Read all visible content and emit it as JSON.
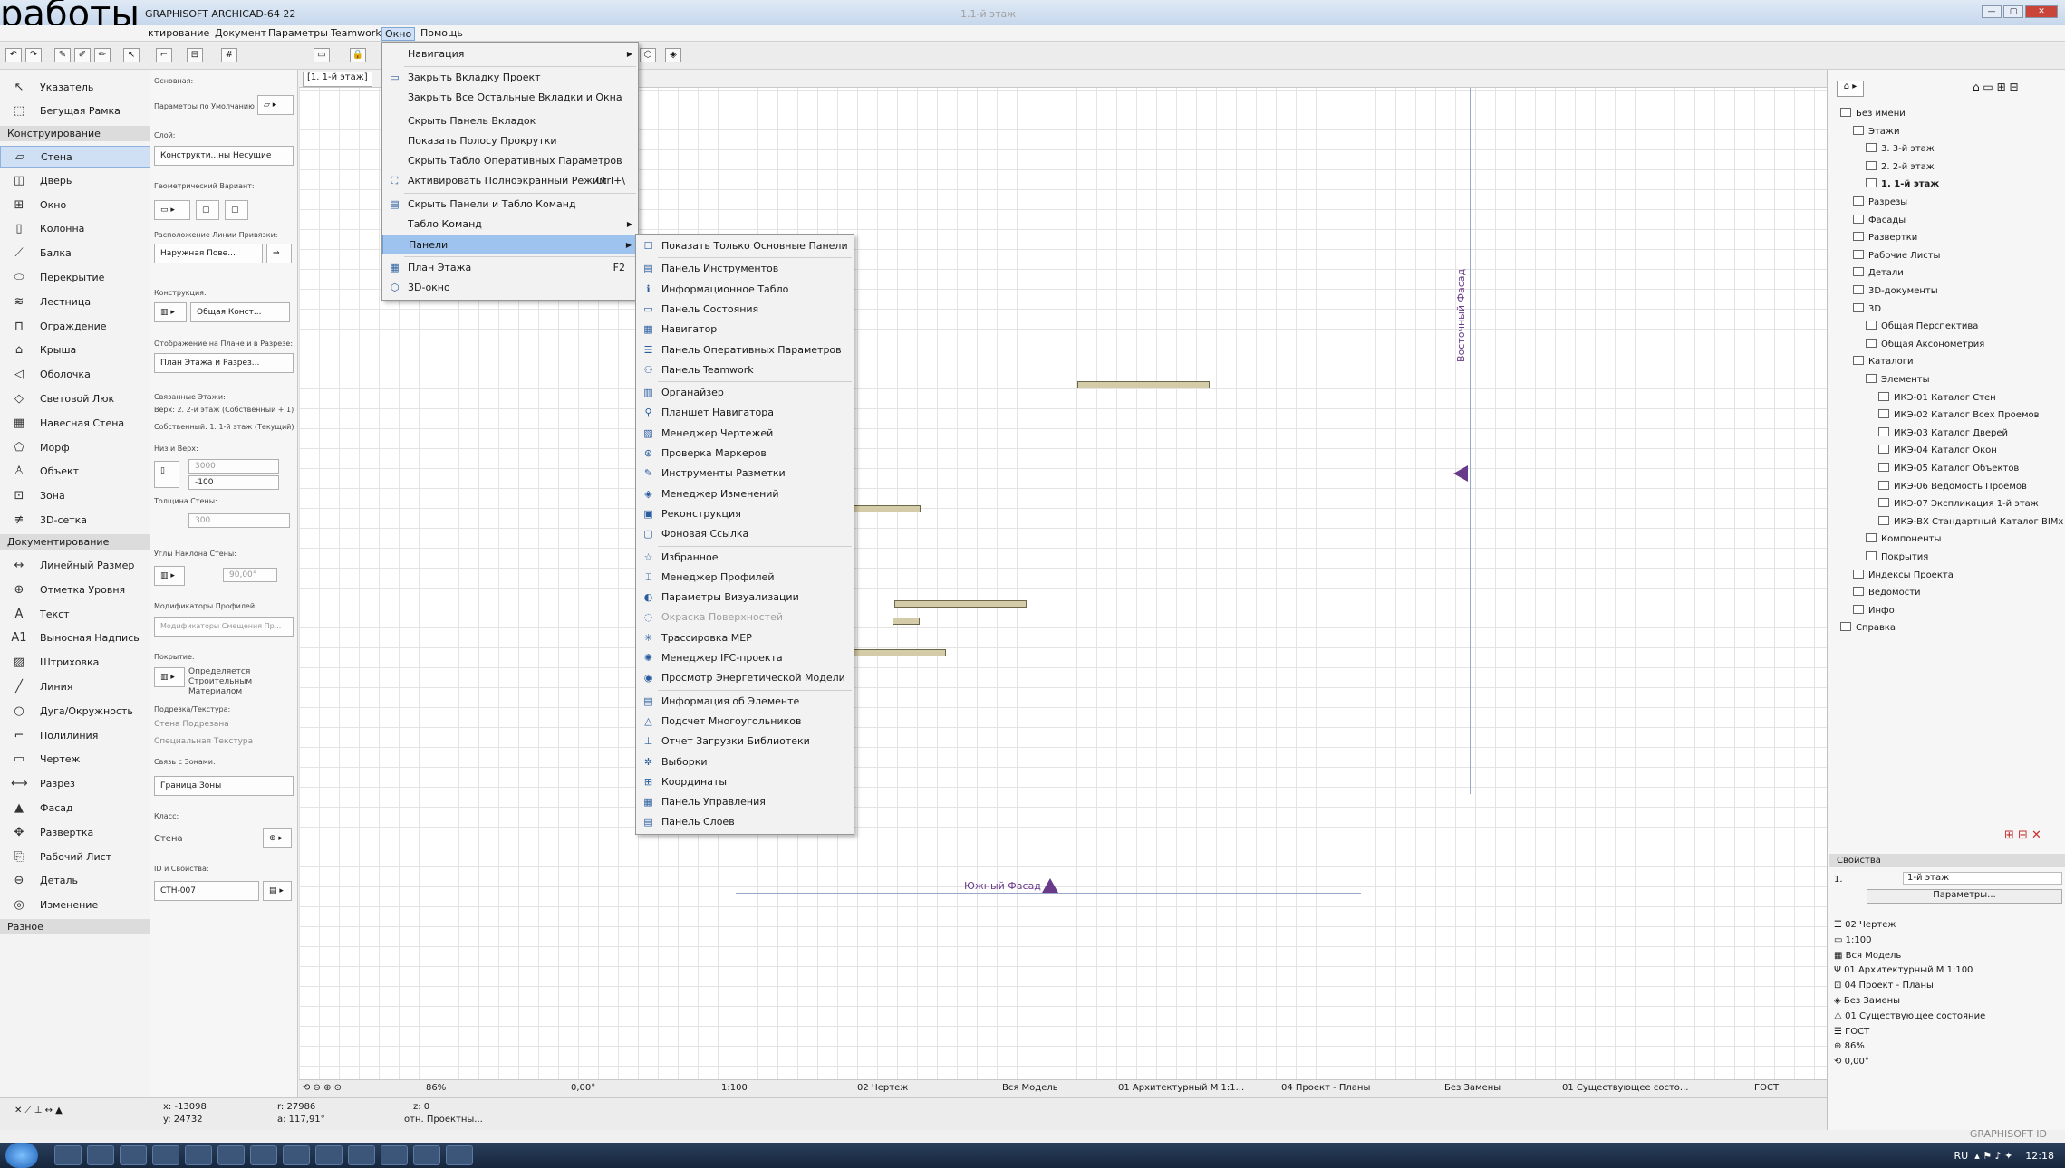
{
  "overlay_caption": "работы",
  "app": {
    "title": "GRAPHISOFT ARCHICAD-64 22",
    "doc_title": "1.1-й этаж"
  },
  "menubar": [
    "ктирование",
    "Документ",
    "Параметры",
    "Teamwork",
    "Окно",
    "Помощь"
  ],
  "window_menu": {
    "items": [
      {
        "label": "Навигация",
        "arrow": "▶"
      },
      {
        "label": "Закрыть Вкладку Проект",
        "icon": "close-tab-icon"
      },
      {
        "label": "Закрыть Все Остальные Вкладки и Окна"
      },
      {
        "label": "Скрыть Панель Вкладок"
      },
      {
        "label": "Показать Полосу Прокрутки"
      },
      {
        "label": "Скрыть Табло Оперативных Параметров"
      },
      {
        "label": "Активировать Полноэкранный Режим",
        "key": "Ctrl+\\",
        "icon": "fullscreen-icon"
      },
      {
        "label": "Скрыть Панели и Табло Команд",
        "icon": "hide-panels-icon"
      },
      {
        "label": "Табло Команд",
        "arrow": "▶"
      },
      {
        "label": "Панели",
        "arrow": "▶",
        "highlighted": true
      },
      {
        "label": "План Этажа",
        "key": "F2",
        "icon": "floor-plan-icon"
      },
      {
        "label": "3D-окно",
        "icon": "3d-window-icon"
      }
    ]
  },
  "panels_submenu": {
    "items": [
      {
        "label": "Показать Только Основные Панели",
        "icon": "☐"
      },
      {
        "label": "Панель Инструментов",
        "icon": "▤"
      },
      {
        "label": "Информационное Табло",
        "icon": "ℹ"
      },
      {
        "label": "Панель Состояния",
        "icon": "▭"
      },
      {
        "label": "Навигатор",
        "icon": "▦"
      },
      {
        "label": "Панель Оперативных Параметров",
        "icon": "☰"
      },
      {
        "label": "Панель Teamwork",
        "icon": "⚇"
      },
      {
        "label": "Органайзер",
        "icon": "▥"
      },
      {
        "label": "Планшет Навигатора",
        "icon": "⚲"
      },
      {
        "label": "Менеджер Чертежей",
        "icon": "▧"
      },
      {
        "label": "Проверка Маркеров",
        "icon": "⊛"
      },
      {
        "label": "Инструменты Разметки",
        "icon": "✎"
      },
      {
        "label": "Менеджер Изменений",
        "icon": "◈"
      },
      {
        "label": "Реконструкция",
        "icon": "▣"
      },
      {
        "label": "Фоновая Ссылка",
        "icon": "▢"
      },
      {
        "label": "Избранное",
        "icon": "☆"
      },
      {
        "label": "Менеджер Профилей",
        "icon": "⌶"
      },
      {
        "label": "Параметры Визуализации",
        "icon": "◐"
      },
      {
        "label": "Окраска Поверхностей",
        "icon": "◌",
        "disabled": true
      },
      {
        "label": "Трассировка MEP",
        "icon": "✳"
      },
      {
        "label": "Менеджер IFC-проекта",
        "icon": "✺"
      },
      {
        "label": "Просмотр Энергетической Модели",
        "icon": "◉"
      },
      {
        "label": "Информация об Элементе",
        "icon": "▤"
      },
      {
        "label": "Подсчет Многоугольников",
        "icon": "△"
      },
      {
        "label": "Отчет Загрузки Библиотеки",
        "icon": "⊥"
      },
      {
        "label": "Выборки",
        "icon": "✲"
      },
      {
        "label": "Координаты",
        "icon": "⊞"
      },
      {
        "label": "Панель Управления",
        "icon": "▦"
      },
      {
        "label": "Панель Слоев",
        "icon": "▤"
      }
    ]
  },
  "toolbox": {
    "top": [
      {
        "label": "Указатель",
        "icon": "↖"
      },
      {
        "label": "Бегущая Рамка",
        "icon": "⬚"
      }
    ],
    "group1": "Конструирование",
    "construct": [
      {
        "label": "Стена",
        "icon": "▱",
        "selected": true
      },
      {
        "label": "Дверь",
        "icon": "◫"
      },
      {
        "label": "Окно",
        "icon": "⊞"
      },
      {
        "label": "Колонна",
        "icon": "▯"
      },
      {
        "label": "Балка",
        "icon": "⟋"
      },
      {
        "label": "Перекрытие",
        "icon": "⬭"
      },
      {
        "label": "Лестница",
        "icon": "≋"
      },
      {
        "label": "Ограждение",
        "icon": "⊓"
      },
      {
        "label": "Крыша",
        "icon": "⌂"
      },
      {
        "label": "Оболочка",
        "icon": "◁"
      },
      {
        "label": "Световой Люк",
        "icon": "◇"
      },
      {
        "label": "Навесная Стена",
        "icon": "▦"
      },
      {
        "label": "Морф",
        "icon": "⬠"
      },
      {
        "label": "Объект",
        "icon": "♙"
      },
      {
        "label": "Зона",
        "icon": "⊡"
      },
      {
        "label": "3D-сетка",
        "icon": "≢"
      }
    ],
    "group2": "Документирование",
    "document": [
      {
        "label": "Линейный Размер",
        "icon": "↔"
      },
      {
        "label": "Отметка Уровня",
        "icon": "⊕"
      },
      {
        "label": "Текст",
        "icon": "A"
      },
      {
        "label": "Выносная Надпись",
        "icon": "A1"
      },
      {
        "label": "Штриховка",
        "icon": "▨"
      },
      {
        "label": "Линия",
        "icon": "╱"
      },
      {
        "label": "Дуга/Окружность",
        "icon": "○"
      },
      {
        "label": "Полилиния",
        "icon": "⌐"
      },
      {
        "label": "Чертеж",
        "icon": "▭"
      },
      {
        "label": "Разрез",
        "icon": "⟷"
      },
      {
        "label": "Фасад",
        "icon": "▲"
      },
      {
        "label": "Развертка",
        "icon": "✥"
      },
      {
        "label": "Рабочий Лист",
        "icon": "⎘"
      },
      {
        "label": "Деталь",
        "icon": "⊖"
      },
      {
        "label": "Изменение",
        "icon": "◎"
      }
    ],
    "group3": "Разное"
  },
  "infobox": {
    "basic": "Основная:",
    "default_params": "Параметры по Умолчанию",
    "layer_label": "Слой:",
    "layer_value": "Конструкти...ны Несущие",
    "geom_label": "Геометрический Вариант:",
    "refline_label": "Расположение Линии Привязки:",
    "refline_value": "Наружная Пове...",
    "structure_label": "Конструкция:",
    "structure_value": "Общая Конст...",
    "display_label": "Отображение на Плане и в Разрезе:",
    "display_value": "План Этажа и Разрез...",
    "linked_label": "Связанные Этажи:",
    "top_link": "Верх:   2. 2-й этаж (Собственный + 1)",
    "home_link": "Собственный:   1. 1-й этаж (Текущий)",
    "bottom_top_label": "Низ и Верх:",
    "height_value": "3000",
    "offset_value": "-100",
    "thickness_label": "Толщина Стены:",
    "thickness_value": "300",
    "angles_label": "Углы Наклона Стены:",
    "angle_value": "90,00°",
    "profile_mod_label": "Модификаторы Профилей:",
    "profile_mod_value": "Модификаторы Смещения Пр...",
    "surface_label": "Покрытие:",
    "surface_value": "Определяется Строительным Материалом",
    "trim_label": "Подрезка/Текстура:",
    "trim1": "Стена Подрезана",
    "trim2": "Специальная Текстура",
    "zone_label": "Связь с Зонами:",
    "zone_value": "Граница Зоны",
    "class_label": "Класс:",
    "class_value": "Стена",
    "id_label": "ID и Свойства:",
    "id_value": "СТН-007"
  },
  "canvas": {
    "tab": "[1. 1-й этаж]",
    "east_label": "Восточный Фасад",
    "south_label": "Южный Фасад"
  },
  "statusbar": {
    "zoom": "86%",
    "angle": "0,00°",
    "scale": "1:100",
    "layer_combo": "02 Чертеж",
    "model_view": "Вся Модель",
    "pen_set": "01 Архитектурный М 1:1...",
    "dim": "04 Проект - Планы",
    "renovation": "Без Замены",
    "reno_filter": "01 Существующее состо...",
    "standard": "ГОСТ"
  },
  "coords": {
    "x": "x: -13098",
    "y": "y: 24732",
    "r": "r: 27986",
    "a": "a: 117,91°",
    "z": "z: 0",
    "z2": "отн. Проектны..."
  },
  "navigator": {
    "tree": [
      {
        "label": "Без имени",
        "lvl": 0
      },
      {
        "label": "Этажи",
        "lvl": 1
      },
      {
        "label": "3. 3-й этаж",
        "lvl": 2
      },
      {
        "label": "2. 2-й этаж",
        "lvl": 2
      },
      {
        "label": "1. 1-й этаж",
        "lvl": 2,
        "bold": true
      },
      {
        "label": "Разрезы",
        "lvl": 1
      },
      {
        "label": "Фасады",
        "lvl": 1
      },
      {
        "label": "Развертки",
        "lvl": 1
      },
      {
        "label": "Рабочие Листы",
        "lvl": 1
      },
      {
        "label": "Детали",
        "lvl": 1
      },
      {
        "label": "3D-документы",
        "lvl": 1
      },
      {
        "label": "3D",
        "lvl": 1
      },
      {
        "label": "Общая Перспектива",
        "lvl": 2
      },
      {
        "label": "Общая Аксонометрия",
        "lvl": 2
      },
      {
        "label": "Каталоги",
        "lvl": 1
      },
      {
        "label": "Элементы",
        "lvl": 2
      },
      {
        "label": "ИКЭ-01 Каталог Стен",
        "lvl": 3
      },
      {
        "label": "ИКЭ-02 Каталог Всех Проемов",
        "lvl": 3
      },
      {
        "label": "ИКЭ-03 Каталог Дверей",
        "lvl": 3
      },
      {
        "label": "ИКЭ-04 Каталог Окон",
        "lvl": 3
      },
      {
        "label": "ИКЭ-05 Каталог Объектов",
        "lvl": 3
      },
      {
        "label": "ИКЭ-06 Ведомость Проемов",
        "lvl": 3
      },
      {
        "label": "ИКЭ-07 Экспликация 1-й этаж",
        "lvl": 3
      },
      {
        "label": "ИКЭ-ВХ Стандартный Каталог BIMx",
        "lvl": 3
      },
      {
        "label": "Компоненты",
        "lvl": 2
      },
      {
        "label": "Покрытия",
        "lvl": 2
      },
      {
        "label": "Индексы Проекта",
        "lvl": 1
      },
      {
        "label": "Ведомости",
        "lvl": 1
      },
      {
        "label": "Инфо",
        "lvl": 1
      },
      {
        "label": "Справка",
        "lvl": 0
      }
    ],
    "props_title": "Свойства",
    "props_id": "1.",
    "props_name": "1-й этаж",
    "props_button": "Параметры...",
    "settings": [
      {
        "icon": "☰",
        "label": "02 Чертеж"
      },
      {
        "icon": "▭",
        "label": "1:100"
      },
      {
        "icon": "▦",
        "label": "Вся Модель"
      },
      {
        "icon": "Ψ",
        "label": "01 Архитектурный М 1:100"
      },
      {
        "icon": "⊡",
        "label": "04 Проект - Планы"
      },
      {
        "icon": "◈",
        "label": "Без Замены"
      },
      {
        "icon": "⚠",
        "label": "01 Существующее состояние"
      },
      {
        "icon": "☰",
        "label": "ГОСТ"
      },
      {
        "icon": "⊕",
        "label": "86%"
      },
      {
        "icon": "⟲",
        "label": "0,00°"
      }
    ]
  },
  "graphisoft_id": "GRAPHISOFT ID",
  "tray": {
    "lang": "RU",
    "time": "12:18"
  }
}
